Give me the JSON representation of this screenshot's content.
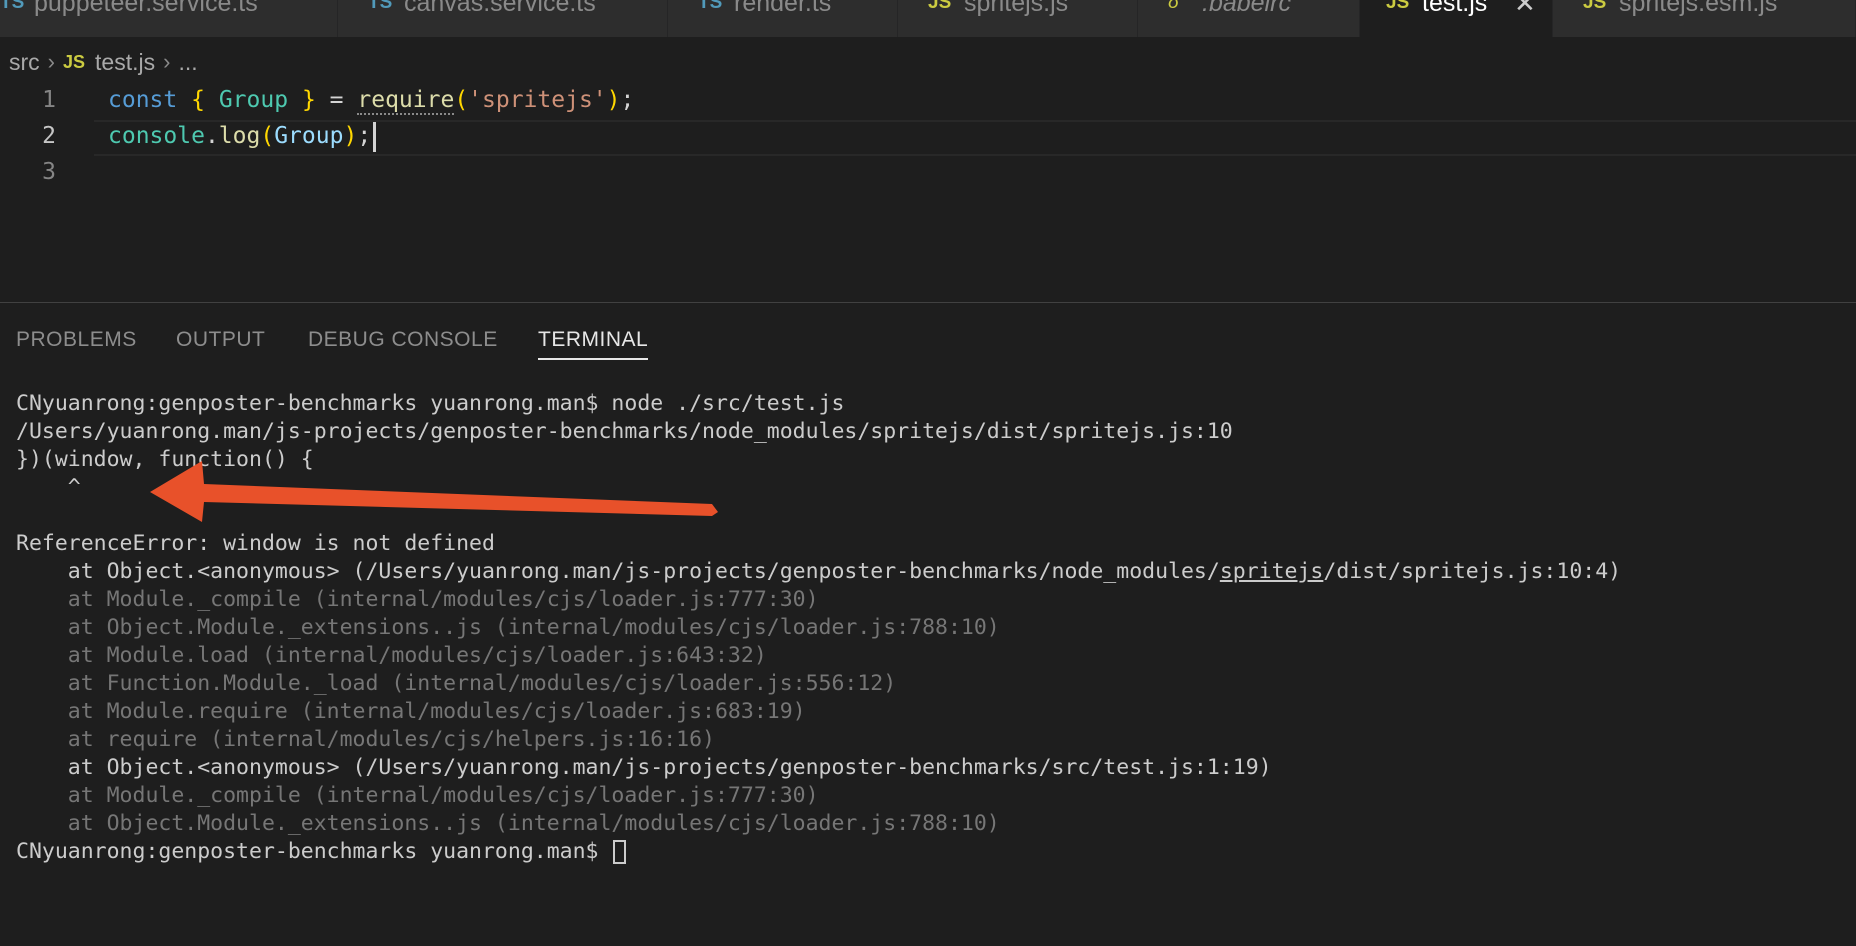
{
  "tabs": [
    {
      "icon": "TS",
      "label": "puppeteer.service.ts",
      "active": false
    },
    {
      "icon": "TS",
      "label": "canvas.service.ts",
      "active": false
    },
    {
      "icon": "TS",
      "label": "render.ts",
      "active": false
    },
    {
      "icon": "JS",
      "label": "spritejs.js",
      "active": false
    },
    {
      "icon": "babel",
      "label": ".babelrc",
      "active": false
    },
    {
      "icon": "JS",
      "label": "test.js",
      "active": true,
      "close": "✕"
    },
    {
      "icon": "JS",
      "label": "spritejs.esm.js",
      "active": false
    }
  ],
  "breadcrumb": {
    "folder": "src",
    "file_icon": "JS",
    "file": "test.js",
    "more": "..."
  },
  "editor": {
    "line_numbers": [
      "1",
      "2",
      "3"
    ],
    "current_line": 2,
    "lines": {
      "l1": {
        "kw": "const",
        "lb": "{",
        "name": "Group",
        "rb": "}",
        "eq": "=",
        "fn": "require",
        "lp": "(",
        "str": "'spritejs'",
        "rp": ")",
        "semi": ";"
      },
      "l2": {
        "obj": "console",
        "dot": ".",
        "fn": "log",
        "lp": "(",
        "arg": "Group",
        "rp": ")",
        "semi": ";"
      }
    }
  },
  "panel": {
    "tabs": [
      "PROBLEMS",
      "OUTPUT",
      "DEBUG CONSOLE",
      "TERMINAL"
    ],
    "active_tab": "TERMINAL"
  },
  "terminal": {
    "lines": [
      "CNyuanrong:genposter-benchmarks yuanrong.man$ node ./src/test.js",
      "/Users/yuanrong.man/js-projects/genposter-benchmarks/node_modules/spritejs/dist/spritejs.js:10",
      "})(window, function() {",
      "    ^",
      "",
      "ReferenceError: window is not defined",
      "    at Module._compile (internal/modules/cjs/loader.js:777:30)",
      "    at Object.Module._extensions..js (internal/modules/cjs/loader.js:788:10)",
      "    at Module.load (internal/modules/cjs/loader.js:643:32)",
      "    at Function.Module._load (internal/modules/cjs/loader.js:556:12)",
      "    at Module.require (internal/modules/cjs/loader.js:683:19)",
      "    at require (internal/modules/cjs/helpers.js:16:16)",
      "    at Object.<anonymous> (/Users/yuanrong.man/js-projects/genposter-benchmarks/src/test.js:1:19)",
      "    at Module._compile (internal/modules/cjs/loader.js:777:30)",
      "    at Object.Module._extensions..js (internal/modules/cjs/loader.js:788:10)",
      "CNyuanrong:genposter-benchmarks yuanrong.man$ "
    ],
    "stack_first": {
      "pre": "    at Object.<anonymous> (/Users/yuanrong.man/js-projects/genposter-benchmarks/node_modules/",
      "link": "spritejs",
      "post": "/dist/spritejs.js:10:4)"
    }
  },
  "colors": {
    "arrow": "#e8512a",
    "js_icon": "#cbcb41",
    "ts_icon": "#519aba",
    "babel_icon": "#cbcb41"
  }
}
